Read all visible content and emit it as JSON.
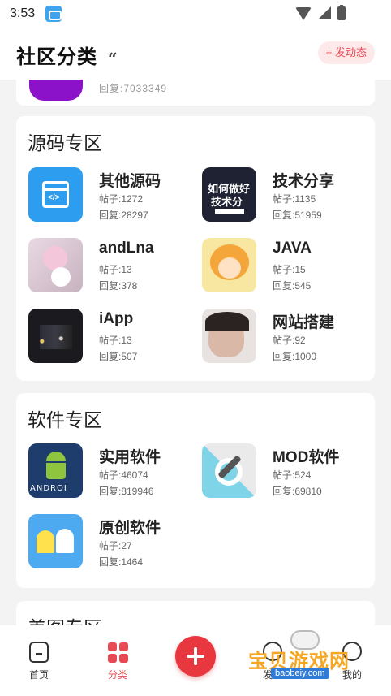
{
  "status_bar": {
    "time": "3:53",
    "icons": [
      "wifi-icon",
      "signal-icon",
      "battery-icon"
    ]
  },
  "header": {
    "title": "社区分类",
    "post_button": "+ 发动态"
  },
  "previous_section": {
    "partial_text": "回复:7033349"
  },
  "sections": [
    {
      "title": "源码专区",
      "items": [
        {
          "name": "其他源码",
          "posts": "帖子:1272",
          "replies": "回复:28297",
          "thumb": "code-window-icon"
        },
        {
          "name": "技术分享",
          "posts": "帖子:1135",
          "replies": "回复:51959",
          "thumb": "tech-share-image",
          "thumb_text": [
            "如何做好",
            "技术分"
          ]
        },
        {
          "name": "andLna",
          "posts": "帖子:13",
          "replies": "回复:378",
          "thumb": "anime-image"
        },
        {
          "name": "JAVA",
          "posts": "帖子:15",
          "replies": "回复:545",
          "thumb": "anime-fox-image"
        },
        {
          "name": "iApp",
          "posts": "帖子:13",
          "replies": "回复:507",
          "thumb": "night-street-image"
        },
        {
          "name": "网站搭建",
          "posts": "帖子:92",
          "replies": "回复:1000",
          "thumb": "portrait-image"
        }
      ]
    },
    {
      "title": "软件专区",
      "items": [
        {
          "name": "实用软件",
          "posts": "帖子:46074",
          "replies": "回复:819946",
          "thumb": "android-robot-image",
          "thumb_text": [
            "ANDROI"
          ]
        },
        {
          "name": "MOD软件",
          "posts": "帖子:524",
          "replies": "回复:69810",
          "thumb": "wrench-gear-image"
        },
        {
          "name": "原创软件",
          "posts": "帖子:27",
          "replies": "回复:1464",
          "thumb": "ghost-image"
        }
      ]
    },
    {
      "title": "美图专区",
      "items": []
    }
  ],
  "tabbar": {
    "tabs": [
      {
        "label": "首页",
        "icon": "home-icon",
        "active": false
      },
      {
        "label": "分类",
        "icon": "category-grid-icon",
        "active": true
      },
      {
        "label": "",
        "icon": "add-icon",
        "active": false
      },
      {
        "label": "发现",
        "icon": "discover-icon",
        "active": false
      },
      {
        "label": "我的",
        "icon": "profile-icon",
        "active": false
      }
    ]
  },
  "watermark": {
    "title": "宝贝游戏网",
    "url": "baobeiy.com"
  },
  "colors": {
    "accent": "#e84a55",
    "add_button": "#e8373f",
    "background": "#f3f3f3"
  }
}
